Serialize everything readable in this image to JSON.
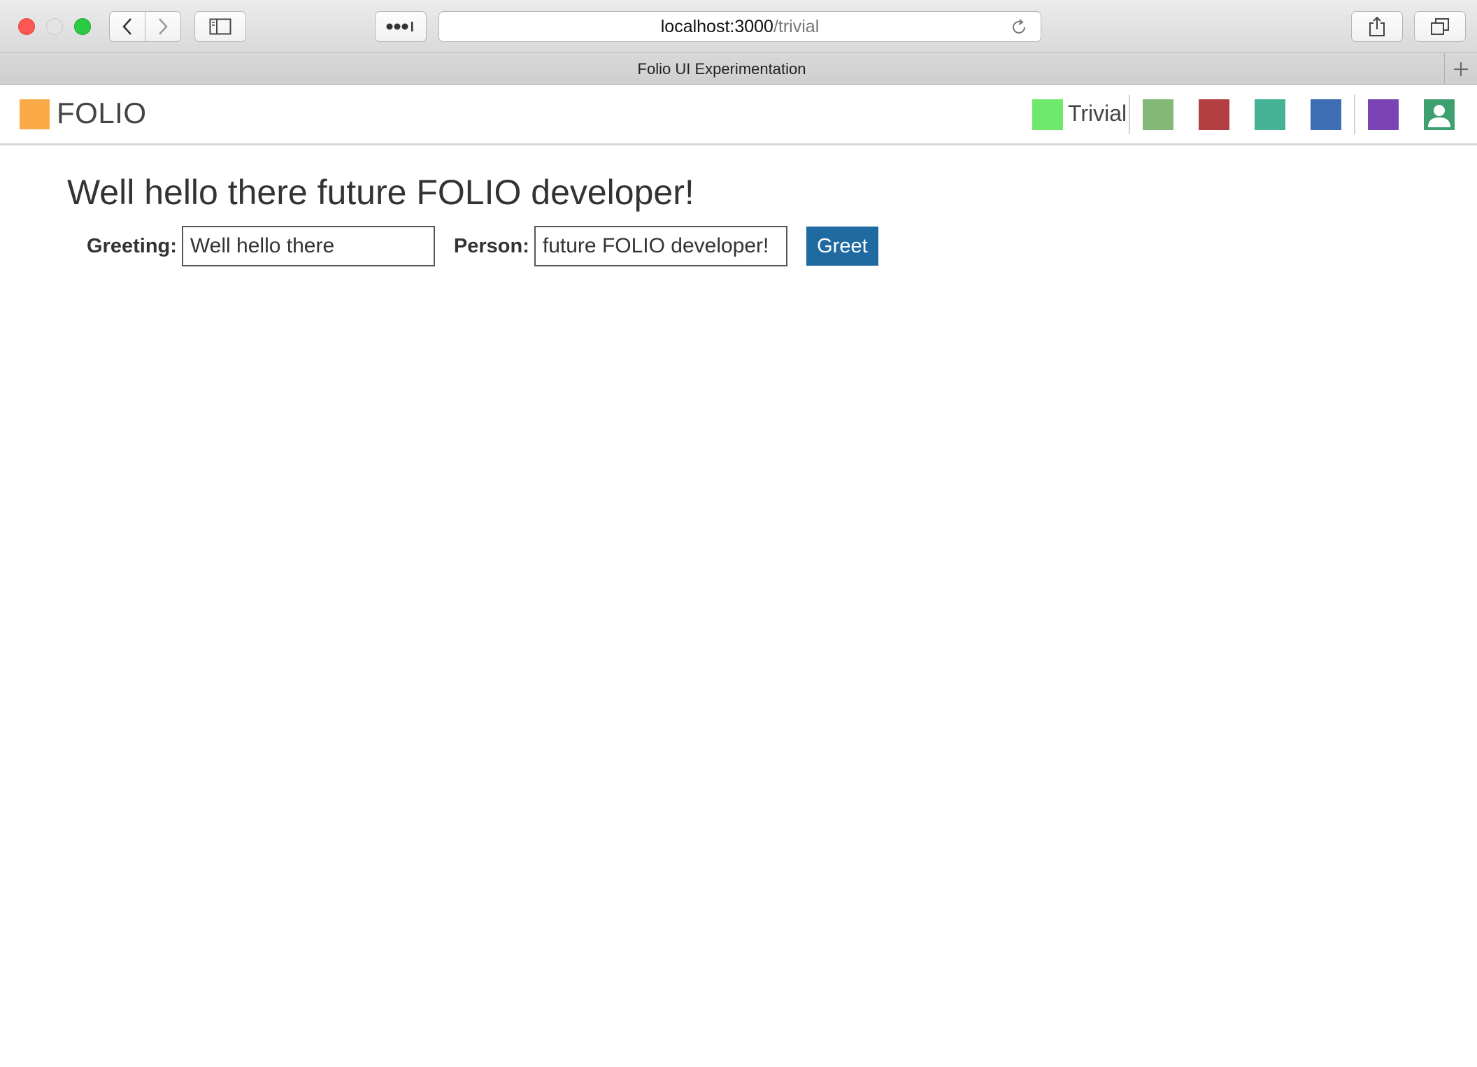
{
  "browser": {
    "url_host": "localhost:3000",
    "url_path": "/trivial",
    "tab_title": "Folio UI Experimentation"
  },
  "app": {
    "logo_text": "FOLIO",
    "logo_color": "#fbaa48",
    "nav": {
      "active_app_label": "Trivial",
      "active_app_color": "#6ee96b",
      "app_colors": [
        "#84b876",
        "#b33f42",
        "#44b395",
        "#3d6db2",
        "#7b44b5"
      ],
      "user_icon_color": "#3ea06f"
    }
  },
  "main": {
    "heading": "Well hello there future FOLIO developer!",
    "greeting_label": "Greeting:",
    "greeting_value": "Well hello there",
    "person_label": "Person:",
    "person_value": "future FOLIO developer!",
    "greet_button": "Greet",
    "button_color": "#1f6aa0"
  }
}
